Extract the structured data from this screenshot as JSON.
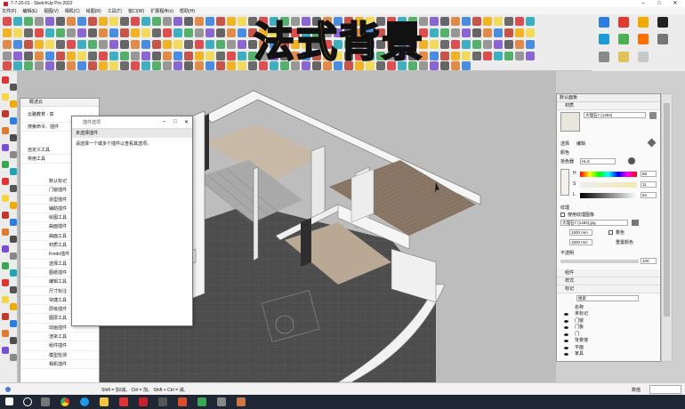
{
  "window": {
    "title": "7-7-20-01 - SketchUp Pro 2022"
  },
  "menu": [
    "文件(F)",
    "编辑(E)",
    "视图(V)",
    "相机(C)",
    "绘图(R)",
    "工具(T)",
    "窗口(W)",
    "扩展程序(x)",
    "帮助(H)"
  ],
  "overlay_title": "法式背景",
  "default_tray": {
    "title": "默认面板",
    "material_section": "材质",
    "material_name": "大理石7 (1484)",
    "tab_select": "选择",
    "tab_edit": "编辑",
    "color_label": "颜色",
    "picker_label": "拾色器",
    "picker_mode": "HLS",
    "h_label": "H",
    "h_value": "56",
    "s_label": "S",
    "s_value": "11",
    "l_label": "L",
    "l_value": "94",
    "texture_label": "纹理",
    "use_texture": "使用纹理图像",
    "texture_file": "大理石7 (1484).jpg",
    "width": "1500 mm",
    "height": "1500 mm",
    "colorize": "着色",
    "reset_color": "重置颜色",
    "opacity_label": "不透明",
    "opacity_value": "100",
    "components": "组件",
    "styles": "样式",
    "tags": "标记",
    "tag_search": "搜索",
    "tag_col_name": "名称",
    "tags_list": [
      "未标记",
      "门窗",
      "门板",
      "门",
      "背景墙",
      "平面",
      "家具"
    ]
  },
  "ext_tray": {
    "title": "概述云",
    "brand": "云路教育 - 高",
    "search_row": "搜索命令、插件",
    "section": "自定义工具",
    "pinned": "常用工具",
    "tools": [
      "默认标记",
      "门窗插件",
      "造型插件",
      "辅助插件",
      "绘图工具",
      "曲面插件",
      "曲面工具",
      "材质工具",
      "Fredo插件",
      "选择工具",
      "图纸插件",
      "编辑工具",
      "尺寸标注",
      "快捷工具",
      "层级插件",
      "图层工具",
      "动画插件",
      "渲染工具",
      "组件插件",
      "模型检测",
      "相机插件"
    ]
  },
  "ext_dialog": {
    "title": "插件选项",
    "header": "未选择插件",
    "message": "请选择一个或多个插件以查看其选项。"
  },
  "status": {
    "hint": "Shift = 加/减。 Ctrl = 加。 Shift + Ctrl = 减。",
    "measure": "数值"
  },
  "colors": {
    "overlay_fill": "#ffd800",
    "taskbar": "#1e2733",
    "floor_wood": "#8a7766",
    "floor_dark": "#4a4a4a"
  }
}
